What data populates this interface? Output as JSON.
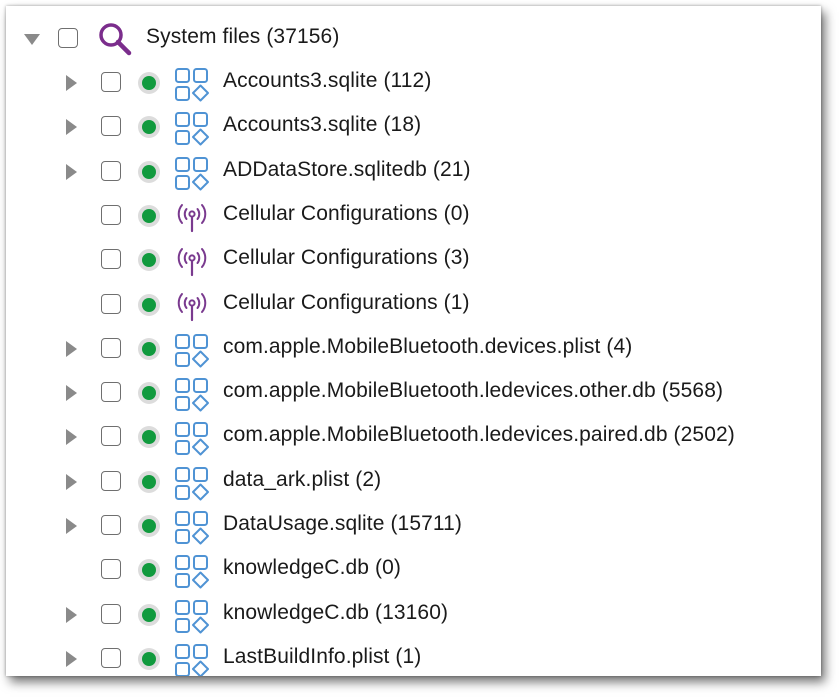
{
  "tree": {
    "root": {
      "label": "System files (37156)",
      "icon": "search-icon",
      "expanded": true
    },
    "items": [
      {
        "label": "Accounts3.sqlite (112)",
        "icon": "file-grid-icon",
        "has_children": true
      },
      {
        "label": "Accounts3.sqlite (18)",
        "icon": "file-grid-icon",
        "has_children": true
      },
      {
        "label": "ADDataStore.sqlitedb (21)",
        "icon": "file-grid-icon",
        "has_children": true
      },
      {
        "label": "Cellular Configurations (0)",
        "icon": "antenna-icon",
        "has_children": false
      },
      {
        "label": "Cellular Configurations (3)",
        "icon": "antenna-icon",
        "has_children": false
      },
      {
        "label": "Cellular Configurations (1)",
        "icon": "antenna-icon",
        "has_children": false
      },
      {
        "label": "com.apple.MobileBluetooth.devices.plist (4)",
        "icon": "file-grid-icon",
        "has_children": true
      },
      {
        "label": "com.apple.MobileBluetooth.ledevices.other.db (5568)",
        "icon": "file-grid-icon",
        "has_children": true
      },
      {
        "label": "com.apple.MobileBluetooth.ledevices.paired.db (2502)",
        "icon": "file-grid-icon",
        "has_children": true
      },
      {
        "label": "data_ark.plist (2)",
        "icon": "file-grid-icon",
        "has_children": true
      },
      {
        "label": "DataUsage.sqlite (15711)",
        "icon": "file-grid-icon",
        "has_children": true
      },
      {
        "label": "knowledgeC.db (0)",
        "icon": "file-grid-icon",
        "has_children": false
      },
      {
        "label": "knowledgeC.db (13160)",
        "icon": "file-grid-icon",
        "has_children": true
      },
      {
        "label": "LastBuildInfo.plist (1)",
        "icon": "file-grid-icon",
        "has_children": true
      }
    ]
  },
  "colors": {
    "status_green": "#119a3e",
    "file_icon_blue": "#4f93d4",
    "antenna_purple": "#7a3a8f",
    "search_purple": "#7b2d8c",
    "expander_gray": "#8a8a8a"
  }
}
